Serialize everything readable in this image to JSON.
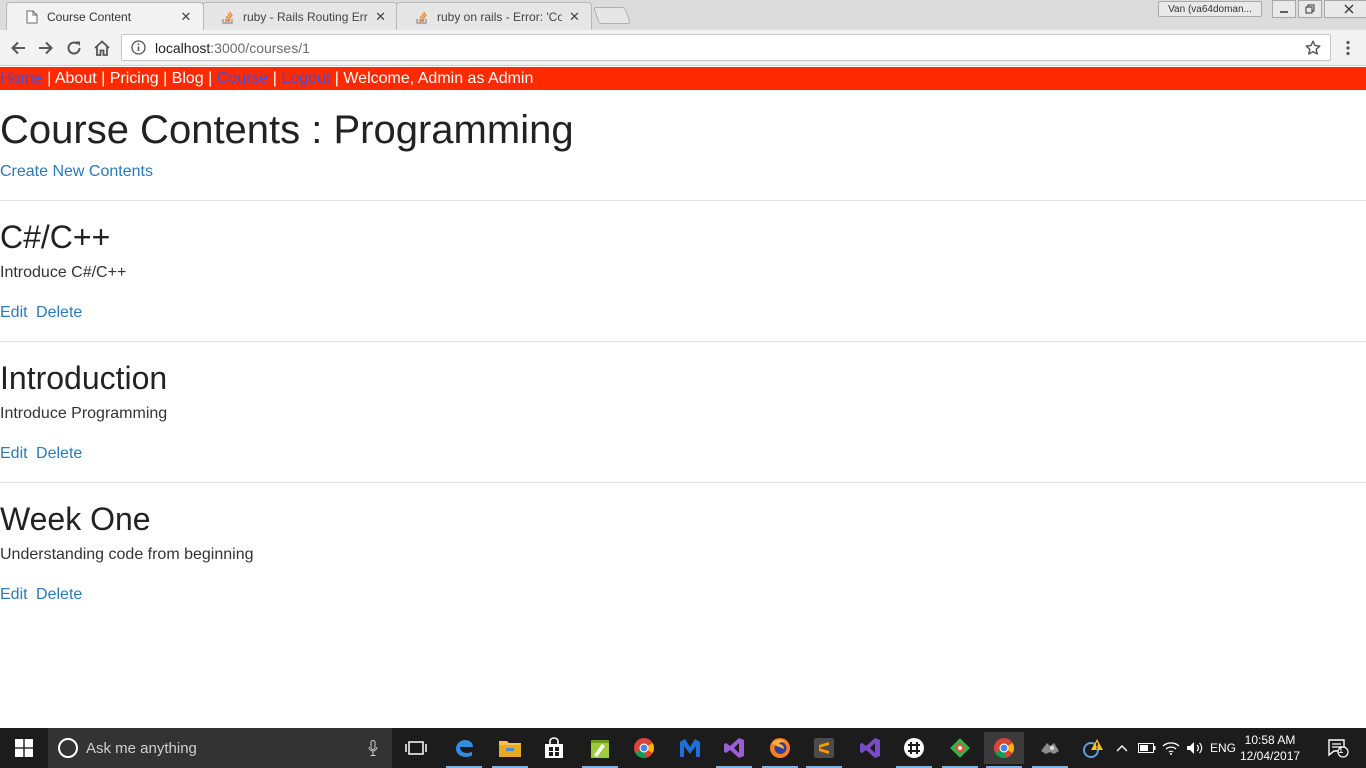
{
  "browser": {
    "tabs": [
      {
        "title": "Course Content",
        "favicon": "page-icon",
        "active": true
      },
      {
        "title": "ruby - Rails Routing Error",
        "favicon": "stackoverflow-icon",
        "active": false
      },
      {
        "title": "ruby on rails - Error: 'Cou",
        "favicon": "stackoverflow-icon",
        "active": false
      }
    ],
    "window_user": "Van (va64doman...",
    "url_host": "localhost",
    "url_path": ":3000/courses/1"
  },
  "nav": {
    "home": "Home",
    "about": "About",
    "pricing": "Pricing",
    "blog": "Blog",
    "course": "Course",
    "logout": "Logout",
    "separator": " | ",
    "welcome": "Welcome, Admin as Admin",
    "bar_color": "#ff2a00",
    "link_color": "#3c4fe0"
  },
  "page": {
    "title": "Course Contents : Programming",
    "create_link": "Create New Contents",
    "link_color": "#2a7ab8"
  },
  "contents": [
    {
      "title": "C#/C++",
      "description": "Introduce C#/C++",
      "edit": "Edit",
      "delete": "Delete"
    },
    {
      "title": "Introduction",
      "description": "Introduce Programming",
      "edit": "Edit",
      "delete": "Delete"
    },
    {
      "title": "Week One",
      "description": "Understanding code from beginning",
      "edit": "Edit",
      "delete": "Delete"
    }
  ],
  "taskbar": {
    "search_placeholder": "Ask me anything",
    "language": "ENG",
    "time": "10:58 AM",
    "date": "12/04/2017",
    "notification_count": "1",
    "icons": [
      "task-view-icon",
      "edge-icon",
      "file-explorer-icon",
      "store-icon",
      "notepad-plus-icon",
      "chrome-icon",
      "malwarebytes-icon",
      "visual-studio-icon",
      "firefox-icon",
      "sublime-text-icon",
      "visual-studio-icon",
      "slack-icon",
      "git-icon",
      "chrome-icon",
      "game-icon"
    ]
  }
}
